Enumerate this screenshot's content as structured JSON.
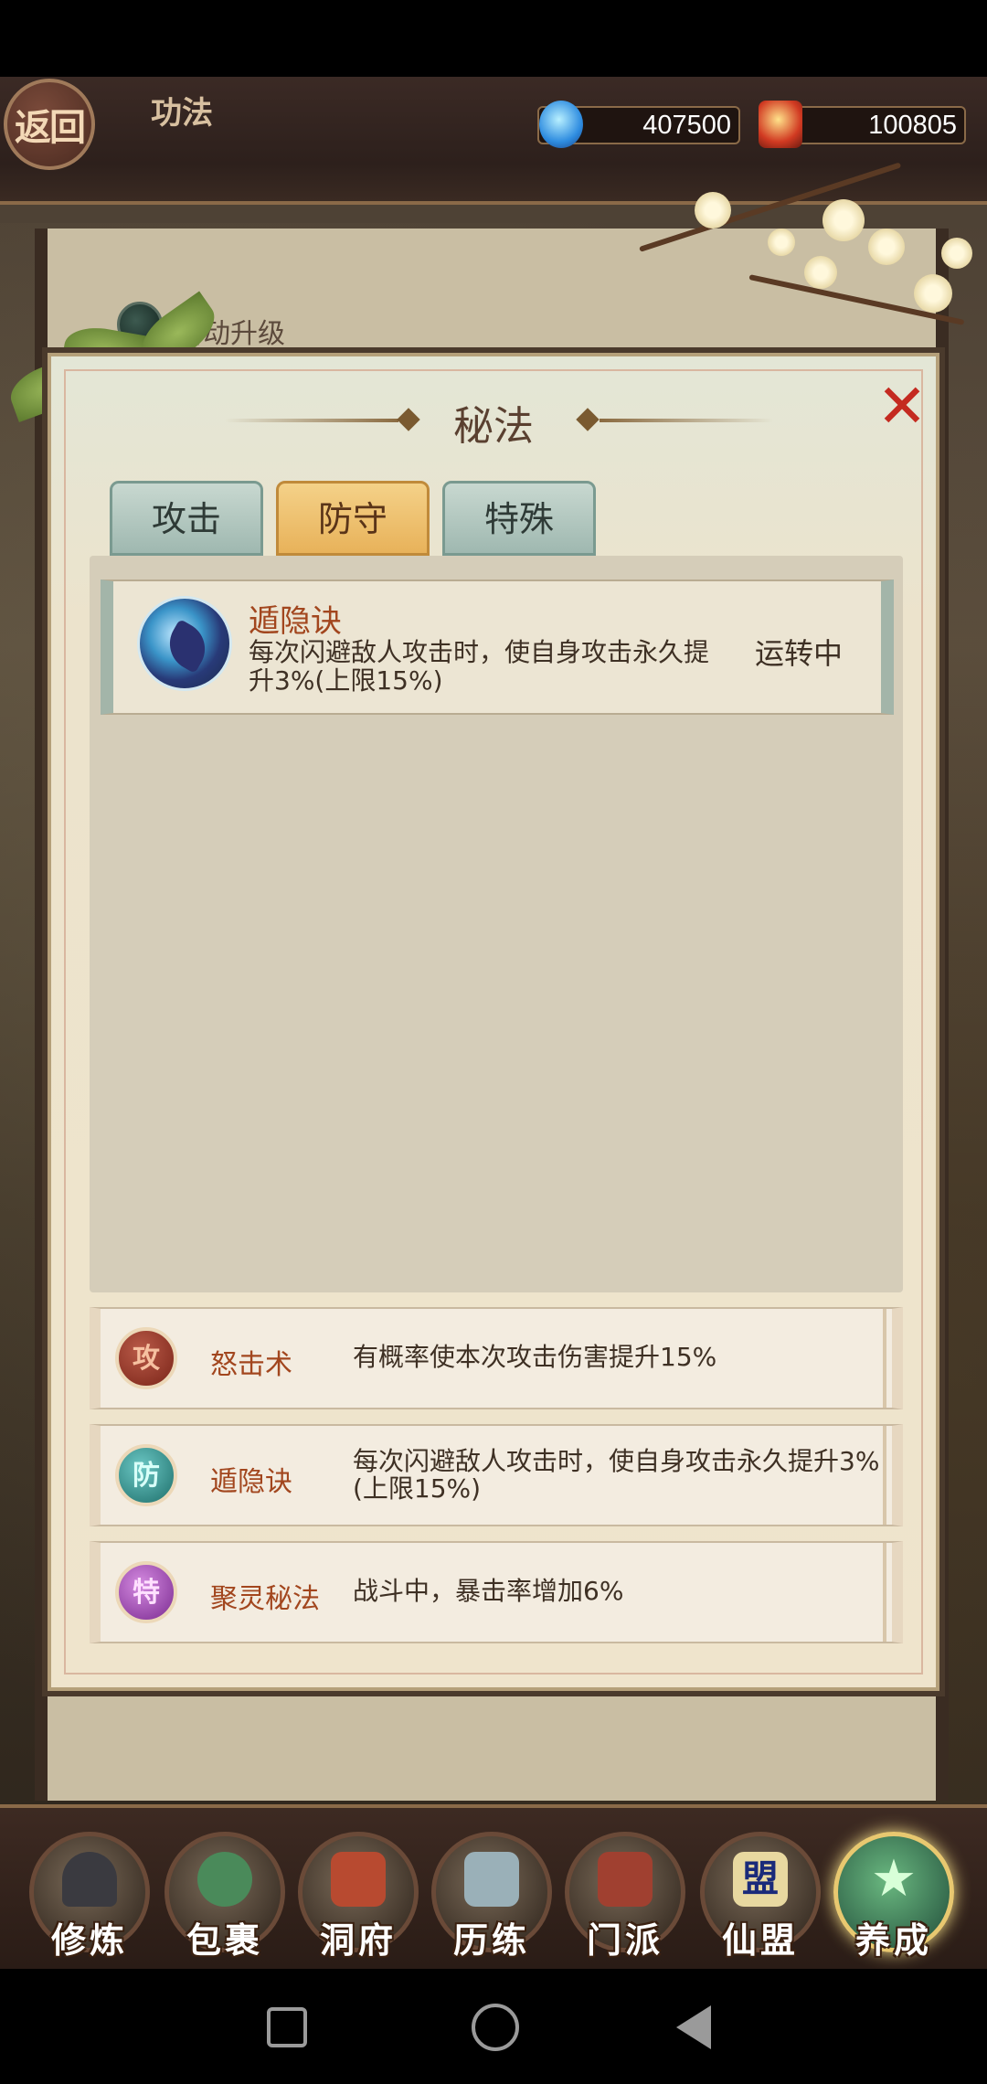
{
  "header": {
    "back_label": "返回",
    "title": "功法",
    "resources": {
      "spirit_stone": "407500",
      "gold_ingot": "100805"
    }
  },
  "background": {
    "auto_upgrade_label": "自动升级"
  },
  "dialog": {
    "title": "秘法",
    "close_icon": "close-x",
    "tabs": [
      {
        "label": "攻击",
        "active": false
      },
      {
        "label": "防守",
        "active": true
      },
      {
        "label": "特殊",
        "active": false
      }
    ],
    "skills": [
      {
        "name": "遁隐诀",
        "description": "每次闪避敌人攻击时，使自身攻击永久提升3%(上限15%)",
        "status": "运转中",
        "icon": "dodge-skill-icon"
      }
    ],
    "equipped": [
      {
        "badge": "攻",
        "name": "怒击术",
        "description": "有概率使本次攻击伤害提升15%"
      },
      {
        "badge": "防",
        "name": "遁隐诀",
        "description": "每次闪避敌人攻击时，使自身攻击永久提升3%(上限15%)"
      },
      {
        "badge": "特",
        "name": "聚灵秘法",
        "description": "战斗中，暴击率增加6%"
      }
    ]
  },
  "bottom_nav": [
    {
      "label": "修炼",
      "icon": "cultivator-icon"
    },
    {
      "label": "包裹",
      "icon": "bag-icon"
    },
    {
      "label": "洞府",
      "icon": "cave-icon"
    },
    {
      "label": "历练",
      "icon": "scroll-icon"
    },
    {
      "label": "门派",
      "icon": "sect-gate-icon"
    },
    {
      "label": "仙盟",
      "icon": "alliance-icon",
      "emblem": "盟"
    },
    {
      "label": "养成",
      "icon": "pentagram-icon",
      "active": true
    }
  ],
  "colors": {
    "active_tab": "#e8b25a",
    "skill_name": "#a2461e",
    "close": "#c42a20"
  }
}
